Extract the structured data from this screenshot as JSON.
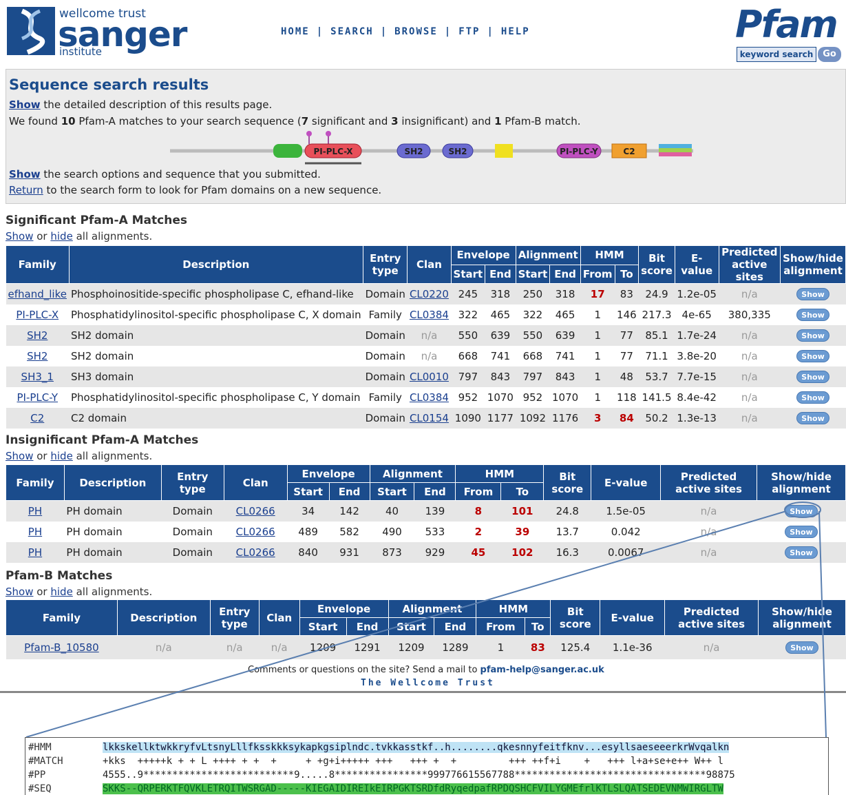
{
  "header": {
    "logo_top": "wellcome trust",
    "logo_main": "sanger",
    "logo_sub": "institute",
    "nav": [
      "HOME",
      "SEARCH",
      "BROWSE",
      "FTP",
      "HELP"
    ],
    "sep": "|",
    "brand": "Pfam",
    "keyword_search": "keyword search",
    "go": "Go"
  },
  "summary": {
    "title": "Sequence search results",
    "show1_link": "Show",
    "show1_text": " the detailed description of this results page.",
    "found_pre": "We found ",
    "pfam_a": "10",
    "found_mid1": " Pfam-A matches to your search sequence (",
    "sig": "7",
    "found_mid2": " significant and ",
    "insig": "3",
    "found_mid3": " insignificant) and ",
    "pfam_b": "1",
    "found_end": " Pfam-B match.",
    "show2_link": "Show",
    "show2_text": " the search options and sequence that you submitted.",
    "return_link": "Return",
    "return_text": " to the search form to look for Pfam domains on a new sequence.",
    "domains": [
      {
        "label": "PI-PLC-X",
        "color": "#e8505a"
      },
      {
        "label": "SH2",
        "color": "#6b6bd0"
      },
      {
        "label": "SH2",
        "color": "#6b6bd0"
      },
      {
        "label": "PI-PLC-Y",
        "color": "#c050c0"
      },
      {
        "label": "C2",
        "color": "#f0a030"
      }
    ]
  },
  "showhide": {
    "show": "Show",
    "or": " or ",
    "hide": "hide",
    "rest": " all alignments."
  },
  "cols": {
    "family": "Family",
    "description": "Description",
    "entry_type": "Entry type",
    "clan": "Clan",
    "envelope": "Envelope",
    "alignment": "Alignment",
    "hmm": "HMM",
    "start": "Start",
    "end": "End",
    "from": "From",
    "to": "To",
    "bit_score": "Bit score",
    "evalue": "E-value",
    "predicted": "Predicted active sites",
    "showhide": "Show/hide alignment",
    "btn": "Show"
  },
  "significant": {
    "heading": "Significant Pfam-A Matches",
    "rows": [
      [
        "efhand_like",
        "Phosphoinositide-specific phospholipase C, efhand-like",
        "Domain",
        "CL0220",
        "245",
        "318",
        "250",
        "318",
        "17",
        "83",
        "24.9",
        "1.2e-05",
        "n/a"
      ],
      [
        "PI-PLC-X",
        "Phosphatidylinositol-specific phospholipase C, X domain",
        "Family",
        "CL0384",
        "322",
        "465",
        "322",
        "465",
        "1",
        "146",
        "217.3",
        "4e-65",
        "380,335"
      ],
      [
        "SH2",
        "SH2 domain",
        "Domain",
        "n/a",
        "550",
        "639",
        "550",
        "639",
        "1",
        "77",
        "85.1",
        "1.7e-24",
        "n/a"
      ],
      [
        "SH2",
        "SH2 domain",
        "Domain",
        "n/a",
        "668",
        "741",
        "668",
        "741",
        "1",
        "77",
        "71.1",
        "3.8e-20",
        "n/a"
      ],
      [
        "SH3_1",
        "SH3 domain",
        "Domain",
        "CL0010",
        "797",
        "843",
        "797",
        "843",
        "1",
        "48",
        "53.7",
        "7.7e-15",
        "n/a"
      ],
      [
        "PI-PLC-Y",
        "Phosphatidylinositol-specific phospholipase C, Y domain",
        "Family",
        "CL0384",
        "952",
        "1070",
        "952",
        "1070",
        "1",
        "118",
        "141.5",
        "8.4e-42",
        "n/a"
      ],
      [
        "C2",
        "C2 domain",
        "Domain",
        "CL0154",
        "1090",
        "1177",
        "1092",
        "1176",
        "3",
        "84",
        "50.2",
        "1.3e-13",
        "n/a"
      ]
    ]
  },
  "insignificant": {
    "heading": "Insignificant Pfam-A Matches",
    "rows": [
      [
        "PH",
        "PH domain",
        "Domain",
        "CL0266",
        "34",
        "142",
        "40",
        "139",
        "8",
        "101",
        "24.8",
        "1.5e-05",
        "n/a"
      ],
      [
        "PH",
        "PH domain",
        "Domain",
        "CL0266",
        "489",
        "582",
        "490",
        "533",
        "2",
        "39",
        "13.7",
        "0.042",
        "n/a"
      ],
      [
        "PH",
        "PH domain",
        "Domain",
        "CL0266",
        "840",
        "931",
        "873",
        "929",
        "45",
        "102",
        "16.3",
        "0.0067",
        "n/a"
      ]
    ]
  },
  "pfamb": {
    "heading": "Pfam-B Matches",
    "rows": [
      [
        "Pfam-B_10580",
        "n/a",
        "n/a",
        "n/a",
        "1209",
        "1291",
        "1209",
        "1289",
        "1",
        "83",
        "125.4",
        "1.1e-36",
        "n/a"
      ]
    ]
  },
  "footer": {
    "comment": "Comments or questions on the site? Send a mail to ",
    "email": "pfam-help@sanger.ac.uk",
    "trust": "The Wellcome Trust"
  },
  "alignment": {
    "labels": [
      "#HMM",
      "#MATCH",
      "#PP",
      "#SEQ"
    ],
    "hmm": "lkkskellktwkkryfvLtsnyLllfkssk​kksykapkgsiplndc.tvkkasstkf..h........qkesnnyfeitfknv...esyllsaeseeerkrWvqalkn",
    "match": "+kks  +++++k + + L ++++ + +  +     + +g+i+++++ +++   +++ +  +         +++ ++f+i    +   +++ l+a+se+e++ W++ l",
    "pp": "4555..9**************************9.....8****************999776615567788*********************************98875",
    "seq": "SKKS--QRPERKTFQVKLETRQITWSRGAD-----KIEGAIDIREIkEIRPGKTSRDfdRyqedpafRPDQSHCFVILYGMEfrlKTLSLQATSEDEVNMWIRGLTW"
  }
}
